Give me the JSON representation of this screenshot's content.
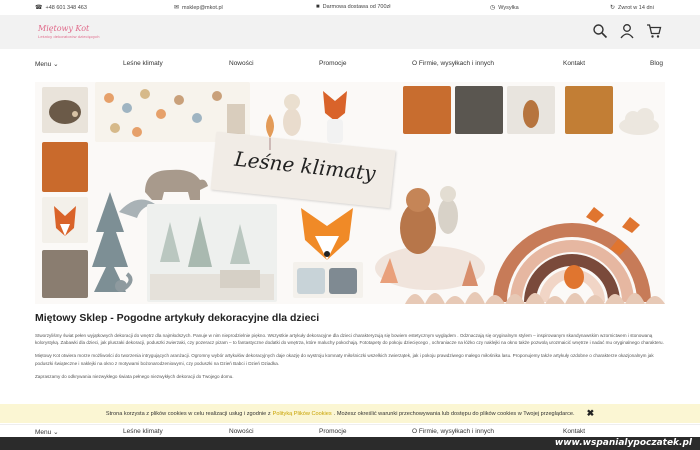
{
  "topbar": {
    "phone": "+48 601 348 463",
    "email": "msklep@mkot.pl",
    "delivery": "Darmowa dostawa od 700zł",
    "shipping": "Wysyłka",
    "returns": "Zwrot w 14 dni"
  },
  "logo": {
    "name": "Miętowy Kot",
    "tagline": "Leśnicy dekoratorów dziecięcych"
  },
  "nav": {
    "menu": "Menu",
    "items": [
      "Leśne klimaty",
      "Nowości",
      "Promocje",
      "O Firmie, wysyłkach i innych",
      "Kontakt",
      "Blog"
    ]
  },
  "banner": {
    "title": "Leśne klimaty"
  },
  "content": {
    "heading": "Miętowy Sklep - Pogodne artykuły dekoracyjne dla dzieci",
    "p1": "Stworzyliśmy świat pełen wyjątkowych dekoracji do wnętrz dla najmłodszych. Panuje w nim nieprodzielnie piękno. Wszystkie artykuły dekoracyjne dla dzieci charakteryzują się bowiem estetycznym wyglądem . Odznaczają się oryginalnym stylem – inspirowanym skandynawskim wzornictwem i stonowaną kolorystyką. Zabawki dla dzieci, jak pluszaki dekoracji, poduszki zwierzaki, czy pozeracz pizam – to fantastyczne dodatki do wnętrza, które maluchy pokochają. Fototapety do pokoju dziecięcego , ochraniacze na łóżko czy naklejki na okno także pozwolą urozmaicić wnętrze i nadać mu oryginalnego charakteru.",
    "p2": "Miętowy Kot otwiera morze możliwości do tworzenia intrygujących aranżacji. Ogromny wybór artykułów dekoracyjnych daje okazję do wystroju komnaty miłośniczki wszelkich zwierzątek, jak i pokoju prawdziwego małego miłośnika lasu. Proponujemy także artykuły ozdobne o charakterze okazjonalnym jak poduszki świąteczne i naklejki na okno z motywami bożonarodzeniowymi, czy poduszki na Dzień Babci i Dzień Dziadka.",
    "p3": "Zapraszamy do odkrywania niezwykłego świata pełnego niezwykłych dekoracji do Twojego domu."
  },
  "cookie": {
    "text_before": "Strona korzysta z plików cookies w celu realizacji usług i zgodnie z",
    "link": "Polityką Plików Cookies",
    "text_after": ". Możesz określić warunki przechowywania lub dostępu do plików cookies w Twojej przeglądarce.",
    "close": "✖"
  },
  "nav2": {
    "menu": "Menu",
    "items": [
      "Leśne klimaty",
      "Nowości",
      "Promocje",
      "O Firmie, wysyłkach i innych",
      "Kontakt"
    ]
  },
  "watermark": "www.wspanialypoczatek.pl",
  "colors": {
    "header_bg": "#f2f2f2",
    "cookie_bg": "#fbf6d3",
    "logo_pink": "#e06a8a",
    "fox": "#e0752f"
  },
  "icons": [
    "phone-icon",
    "email-icon",
    "truck-icon",
    "clock-icon",
    "return-icon",
    "search-icon",
    "user-icon",
    "cart-icon",
    "close-icon"
  ]
}
